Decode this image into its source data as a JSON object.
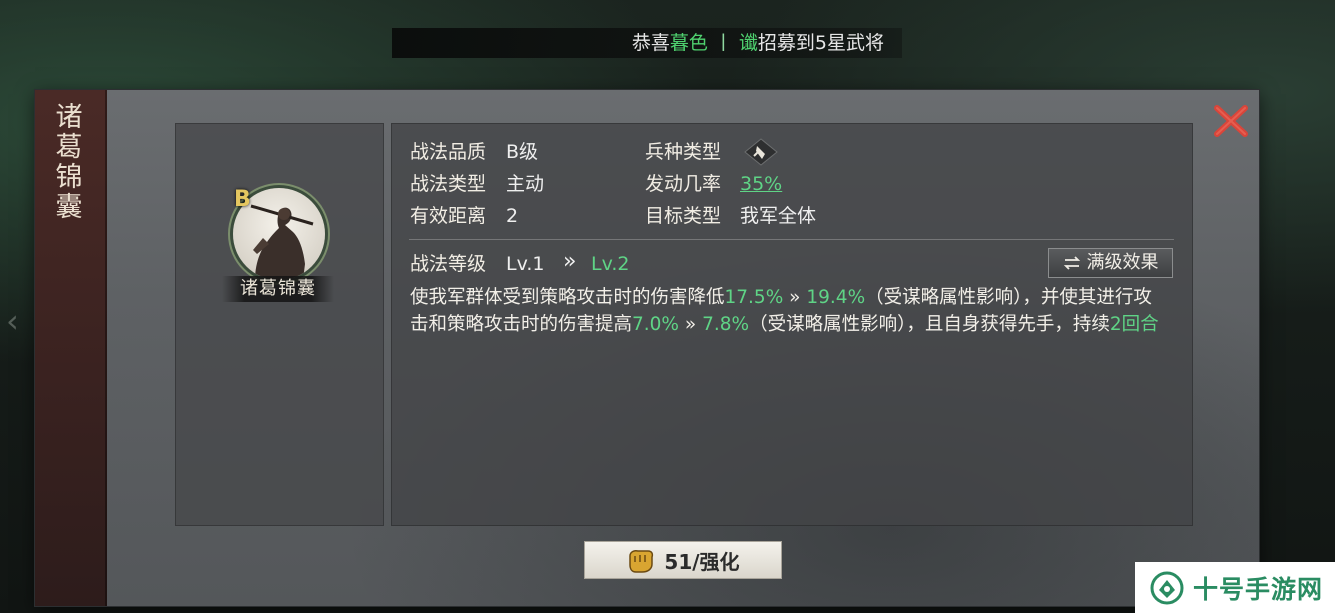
{
  "broadcast": {
    "prefix": "恭喜",
    "player": "暮色",
    "separator": "丨",
    "clan": "谶",
    "message": "招募到5星武将"
  },
  "skill_title": "诸葛锦囊",
  "portrait": {
    "grade": "B",
    "name": "诸葛锦囊"
  },
  "attributes": {
    "quality_label": "战法品质",
    "quality_value": "B级",
    "troop_label": "兵种类型",
    "type_label": "战法类型",
    "type_value": "主动",
    "rate_label": "发动几率",
    "rate_value": "35%",
    "range_label": "有效距离",
    "range_value": "2",
    "target_label": "目标类型",
    "target_value": "我军全体"
  },
  "level": {
    "label": "战法等级",
    "current": "Lv.1",
    "arrow": "»",
    "next": "Lv.2",
    "max_button": "满级效果"
  },
  "description": {
    "p1": "使我军群体受到策略攻击时的伤害降低",
    "v1a": "17.5%",
    "arrow": " » ",
    "v1b": "19.4%",
    "p2": "（受谋略属性影响），并使其进行攻击和策略攻击时的伤害提高",
    "v2a": "7.0%",
    "v2b": "7.8%",
    "p3": "（受谋略属性影响），且自身获得先手，持续",
    "v3": "2回合"
  },
  "upgrade": {
    "label": "51/强化"
  },
  "watermark": {
    "text": "十号手游网"
  },
  "colors": {
    "accent_green": "#5fd486",
    "close_red": "#d9453a",
    "grade_gold": "#e5c760"
  }
}
